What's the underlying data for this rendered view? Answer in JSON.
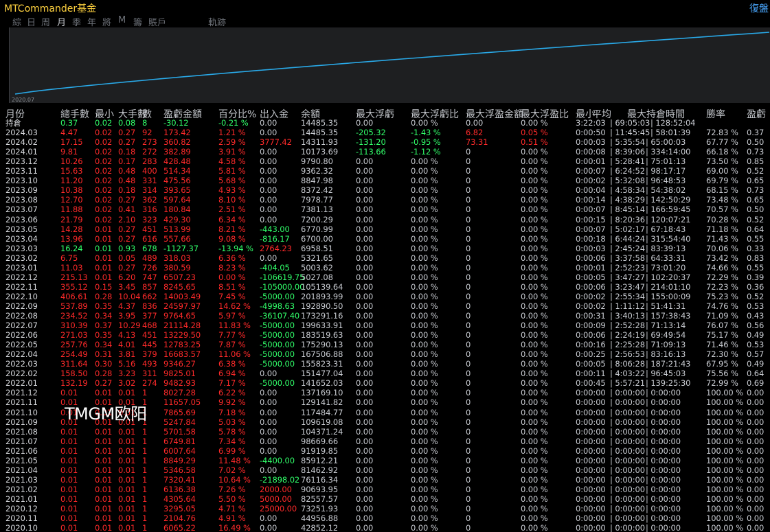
{
  "title": "MTCommander基金",
  "restore_label": "復盤",
  "tabs": [
    "綜",
    "日",
    "周",
    "月",
    "季",
    "年",
    "將",
    "M",
    "籌",
    "賬戶",
    "軌跡"
  ],
  "active_tab": "月",
  "chart": {
    "start_label": "2020.07",
    "line_color": "#29a9e8"
  },
  "columns": [
    "月份",
    "總手數",
    "最小",
    "大手數",
    "數",
    "盈虧金額",
    "百分比%",
    "出入金",
    "余額",
    "最大浮虧",
    "最大浮虧比",
    "最大浮盈金額",
    "最大浮盈比",
    "最小",
    "平均",
    "最大持倉時間",
    "勝率",
    "盈虧"
  ],
  "rows": [
    [
      "持倉",
      "0.37",
      "0.02",
      "0.08",
      "8",
      "-30.12",
      "-0.21 %",
      "0.00",
      "14485.35",
      "0.00",
      "0.00 %",
      "0.00",
      "0.00 %",
      "3:22:03",
      "69:05:03",
      "128:52:04",
      "",
      ""
    ],
    [
      "2024.03",
      "4.47",
      "0.02",
      "0.27",
      "92",
      "173.42",
      "1.21 %",
      "0.00",
      "14485.35",
      "-205.32",
      "-1.43 %",
      "6.82",
      "0.05 %",
      "0:00:50",
      "11:45:45",
      "58:01:39",
      "72.83 %",
      "0.37"
    ],
    [
      "2024.02",
      "17.15",
      "0.02",
      "0.27",
      "273",
      "360.82",
      "2.59 %",
      "3777.42",
      "14311.93",
      "-131.20",
      "-0.95 %",
      "73.31",
      "0.51 %",
      "0:00:03",
      "5:35:54",
      "65:00:03",
      "67.77 %",
      "0.50"
    ],
    [
      "2024.01",
      "9.81",
      "0.02",
      "0.18",
      "272",
      "382.89",
      "3.91 %",
      "0.00",
      "10173.69",
      "-113.66",
      "-1.12 %",
      "0",
      "0.00 %",
      "0:00:08",
      "8:39:06",
      "334:14:00",
      "66.18 %",
      "0.73"
    ],
    [
      "2023.12",
      "10.26",
      "0.02",
      "0.17",
      "283",
      "428.48",
      "4.58 %",
      "0.00",
      "9790.80",
      "0.00",
      "0.00 %",
      "0",
      "0.00 %",
      "0:00:01",
      "5:28:41",
      "75:01:13",
      "73.50 %",
      "0.85"
    ],
    [
      "2023.11",
      "15.63",
      "0.02",
      "0.48",
      "400",
      "514.34",
      "5.81 %",
      "0.00",
      "9362.32",
      "0.00",
      "0.00 %",
      "0",
      "0.00 %",
      "0:00:07",
      "6:24:52",
      "98:17:17",
      "69.00 %",
      "0.52"
    ],
    [
      "2023.10",
      "11.20",
      "0.02",
      "0.48",
      "331",
      "475.56",
      "5.68 %",
      "0.00",
      "8847.98",
      "0.00",
      "0.00 %",
      "0",
      "0.00 %",
      "0:00:02",
      "5:32:08",
      "96:48:53",
      "69.79 %",
      "0.65"
    ],
    [
      "2023.09",
      "10.38",
      "0.02",
      "0.18",
      "314",
      "393.65",
      "4.93 %",
      "0.00",
      "8372.42",
      "0.00",
      "0.00 %",
      "0",
      "0.00 %",
      "0:00:04",
      "4:58:34",
      "54:38:02",
      "68.15 %",
      "0.73"
    ],
    [
      "2023.08",
      "12.70",
      "0.02",
      "0.27",
      "362",
      "597.64",
      "8.10 %",
      "0.00",
      "7978.77",
      "0.00",
      "0.00 %",
      "0",
      "0.00 %",
      "0:00:14",
      "4:38:29",
      "142:50:29",
      "73.48 %",
      "0.65"
    ],
    [
      "2023.07",
      "11.88",
      "0.02",
      "0.41",
      "316",
      "180.84",
      "2.51 %",
      "0.00",
      "7381.13",
      "0.00",
      "0.00 %",
      "0",
      "0.00 %",
      "0:00:07",
      "8:45:14",
      "166:59:45",
      "70.57 %",
      "0.50"
    ],
    [
      "2023.06",
      "21.79",
      "0.02",
      "2.10",
      "323",
      "429.30",
      "6.34 %",
      "0.00",
      "7200.29",
      "0.00",
      "0.00 %",
      "0",
      "0.00 %",
      "0:00:15",
      "8:20:36",
      "120:07:21",
      "70.28 %",
      "0.52"
    ],
    [
      "2023.05",
      "14.28",
      "0.01",
      "0.27",
      "451",
      "513.99",
      "8.21 %",
      "-443.00",
      "6770.99",
      "0.00",
      "0.00 %",
      "0",
      "0.00 %",
      "0:00:07",
      "5:02:17",
      "67:18:43",
      "71.18 %",
      "0.64"
    ],
    [
      "2023.04",
      "13.96",
      "0.01",
      "0.27",
      "616",
      "557.66",
      "9.08 %",
      "-816.17",
      "6700.00",
      "0.00",
      "0.00 %",
      "0",
      "0.00 %",
      "0:00:18",
      "6:44:24",
      "315:54:40",
      "71.43 %",
      "0.55"
    ],
    [
      "2023.03",
      "16.24",
      "0.01",
      "0.93",
      "678",
      "-1127.37",
      "-13.94 %",
      "2764.23",
      "6958.51",
      "0.00",
      "0.00 %",
      "0",
      "0.00 %",
      "0:00:03",
      "2:45:24",
      "83:39:13",
      "70.06 %",
      "0.33"
    ],
    [
      "2023.02",
      "6.75",
      "0.01",
      "0.05",
      "489",
      "318.03",
      "6.36 %",
      "0.00",
      "5321.65",
      "0.00",
      "0.00 %",
      "0",
      "0.00 %",
      "0:00:06",
      "3:37:58",
      "64:33:31",
      "73.42 %",
      "0.83"
    ],
    [
      "2023.01",
      "11.03",
      "0.01",
      "0.27",
      "726",
      "380.59",
      "8.23 %",
      "-404.05",
      "5003.62",
      "0.00",
      "0.00 %",
      "0",
      "0.00 %",
      "0:00:01",
      "2:52:23",
      "73:01:20",
      "74.66 %",
      "0.55"
    ],
    [
      "2022.12",
      "215.13",
      "0.01",
      "6.20",
      "747",
      "6507.23",
      "0.00 %",
      "-106619.75",
      "5027.08",
      "0.00",
      "0.00 %",
      "0",
      "0.00 %",
      "0:00:05",
      "3:47:27",
      "102:20:37",
      "72.29 %",
      "0.39"
    ],
    [
      "2022.11",
      "355.12",
      "0.15",
      "3.45",
      "857",
      "8245.65",
      "8.51 %",
      "-105000.00",
      "105139.64",
      "0.00",
      "0.00 %",
      "0",
      "0.00 %",
      "0:00:06",
      "3:23:47",
      "214:01:10",
      "72.23 %",
      "0.36"
    ],
    [
      "2022.10",
      "406.61",
      "0.28",
      "10.04",
      "662",
      "14003.49",
      "7.45 %",
      "-5000.00",
      "201893.99",
      "0.00",
      "0.00 %",
      "0",
      "0.00 %",
      "0:00:02",
      "2:55:34",
      "155:00:09",
      "75.23 %",
      "0.52"
    ],
    [
      "2022.09",
      "537.89",
      "0.35",
      "4.37",
      "836",
      "24597.97",
      "14.62 %",
      "-4998.63",
      "192890.50",
      "0.00",
      "0.00 %",
      "0",
      "0.00 %",
      "0:00:02",
      "1:11:12",
      "51:41:31",
      "74.76 %",
      "0.53"
    ],
    [
      "2022.08",
      "234.52",
      "0.34",
      "3.95",
      "377",
      "9764.65",
      "5.97 %",
      "-36107.40",
      "173291.16",
      "0.00",
      "0.00 %",
      "0",
      "0.00 %",
      "0:00:31",
      "3:40:13",
      "157:38:43",
      "71.09 %",
      "0.43"
    ],
    [
      "2022.07",
      "310.39",
      "0.37",
      "10.29",
      "468",
      "21114.28",
      "11.83 %",
      "-5000.00",
      "199633.91",
      "0.00",
      "0.00 %",
      "0",
      "0.00 %",
      "0:00:09",
      "2:52:28",
      "71:13:14",
      "76.07 %",
      "0.56"
    ],
    [
      "2022.06",
      "271.03",
      "0.35",
      "4.13",
      "451",
      "13229.50",
      "7.77 %",
      "-5000.00",
      "183519.63",
      "0.00",
      "0.00 %",
      "0",
      "0.00 %",
      "0:00:06",
      "2:24:19",
      "69:49:54",
      "75.17 %",
      "0.49"
    ],
    [
      "2022.05",
      "257.76",
      "0.34",
      "4.01",
      "445",
      "12783.25",
      "7.87 %",
      "-5000.00",
      "175290.13",
      "0.00",
      "0.00 %",
      "0",
      "0.00 %",
      "0:00:16",
      "2:25:28",
      "71:09:13",
      "71.46 %",
      "0.53"
    ],
    [
      "2022.04",
      "254.49",
      "0.31",
      "3.81",
      "379",
      "16683.57",
      "11.06 %",
      "-5000.00",
      "167506.88",
      "0.00",
      "0.00 %",
      "0",
      "0.00 %",
      "0:00:25",
      "2:56:53",
      "83:16:13",
      "72.30 %",
      "0.57"
    ],
    [
      "2022.03",
      "311.64",
      "0.30",
      "5.16",
      "493",
      "9346.27",
      "6.38 %",
      "-5000.00",
      "155823.31",
      "0.00",
      "0.00 %",
      "0",
      "0.00 %",
      "0:00:05",
      "8:06:28",
      "187:21:43",
      "67.95 %",
      "0.49"
    ],
    [
      "2022.02",
      "158.50",
      "0.28",
      "3.23",
      "311",
      "9825.01",
      "6.94 %",
      "0.00",
      "151477.04",
      "0.00",
      "0.00 %",
      "0",
      "0.00 %",
      "0:00:11",
      "4:03:22",
      "96:45:03",
      "75.56 %",
      "0.64"
    ],
    [
      "2022.01",
      "132.19",
      "0.27",
      "3.02",
      "274",
      "9482.93",
      "7.17 %",
      "-5000.00",
      "141652.03",
      "0.00",
      "0.00 %",
      "0",
      "0.00 %",
      "0:00:45",
      "5:57:21",
      "139:25:30",
      "72.99 %",
      "0.69"
    ],
    [
      "2021.12",
      "0.01",
      "0.01",
      "0.01",
      "1",
      "8027.28",
      "6.22 %",
      "0.00",
      "137169.10",
      "0.00",
      "0.00 %",
      "0",
      "0.00 %",
      "0:00:00",
      "0:00:00",
      "0:00:00",
      "100.00 %",
      "0.00"
    ],
    [
      "2021.11",
      "0.01",
      "0.01",
      "0.01",
      "1",
      "11657.05",
      "9.92 %",
      "0.00",
      "129141.82",
      "0.00",
      "0.00 %",
      "0",
      "0.00 %",
      "0:00:00",
      "0:00:00",
      "0:00:00",
      "100.00 %",
      "0.00"
    ],
    [
      "2021.10",
      "0.01",
      "0.01",
      "0.01",
      "1",
      "7865.69",
      "7.18 %",
      "0.00",
      "117484.77",
      "0.00",
      "0.00 %",
      "0",
      "0.00 %",
      "0:00:00",
      "0:00:00",
      "0:00:00",
      "100.00 %",
      "0.00"
    ],
    [
      "2021.09",
      "0.01",
      "0.01",
      "0.01",
      "1",
      "5247.84",
      "5.03 %",
      "0.00",
      "109619.08",
      "0.00",
      "0.00 %",
      "0",
      "0.00 %",
      "0:00:00",
      "0:00:00",
      "0:00:00",
      "100.00 %",
      "0.00"
    ],
    [
      "2021.08",
      "0.01",
      "0.01",
      "0.01",
      "1",
      "5701.58",
      "5.78 %",
      "0.00",
      "104371.24",
      "0.00",
      "0.00 %",
      "0",
      "0.00 %",
      "0:00:00",
      "0:00:00",
      "0:00:00",
      "100.00 %",
      "0.00"
    ],
    [
      "2021.07",
      "0.01",
      "0.01",
      "0.01",
      "1",
      "6749.81",
      "7.34 %",
      "0.00",
      "98669.66",
      "0.00",
      "0.00 %",
      "0",
      "0.00 %",
      "0:00:00",
      "0:00:00",
      "0:00:00",
      "100.00 %",
      "0.00"
    ],
    [
      "2021.06",
      "0.01",
      "0.01",
      "0.01",
      "1",
      "6007.64",
      "6.99 %",
      "0.00",
      "91919.85",
      "0.00",
      "0.00 %",
      "0",
      "0.00 %",
      "0:00:00",
      "0:00:00",
      "0:00:00",
      "100.00 %",
      "0.00"
    ],
    [
      "2021.05",
      "0.01",
      "0.01",
      "0.01",
      "1",
      "8849.29",
      "11.48 %",
      "-4400.00",
      "85912.21",
      "0.00",
      "0.00 %",
      "0",
      "0.00 %",
      "0:00:00",
      "0:00:00",
      "0:00:00",
      "100.00 %",
      "0.00"
    ],
    [
      "2021.04",
      "0.01",
      "0.01",
      "0.01",
      "1",
      "5346.58",
      "7.02 %",
      "0.00",
      "81462.92",
      "0.00",
      "0.00 %",
      "0",
      "0.00 %",
      "0:00:00",
      "0:00:00",
      "0:00:00",
      "100.00 %",
      "0.00"
    ],
    [
      "2021.03",
      "0.01",
      "0.01",
      "0.01",
      "1",
      "7320.41",
      "10.64 %",
      "-21898.02",
      "76116.34",
      "0.00",
      "0.00 %",
      "0",
      "0.00 %",
      "0:00:00",
      "0:00:00",
      "0:00:00",
      "100.00 %",
      "0.00"
    ],
    [
      "2021.02",
      "0.01",
      "0.01",
      "0.01",
      "1",
      "6136.38",
      "7.26 %",
      "2000.00",
      "90693.95",
      "0.00",
      "0.00 %",
      "0",
      "0.00 %",
      "0:00:00",
      "0:00:00",
      "0:00:00",
      "100.00 %",
      "0.00"
    ],
    [
      "2021.01",
      "0.01",
      "0.01",
      "0.01",
      "1",
      "4305.64",
      "5.50 %",
      "5000.00",
      "82557.57",
      "0.00",
      "0.00 %",
      "0",
      "0.00 %",
      "0:00:00",
      "0:00:00",
      "0:00:00",
      "100.00 %",
      "0.00"
    ],
    [
      "2020.12",
      "0.01",
      "0.01",
      "0.01",
      "1",
      "3295.05",
      "4.71 %",
      "25000.00",
      "73251.93",
      "0.00",
      "0.00 %",
      "0",
      "0.00 %",
      "0:00:00",
      "0:00:00",
      "0:00:00",
      "100.00 %",
      "0.00"
    ],
    [
      "2020.11",
      "0.01",
      "0.01",
      "0.01",
      "1",
      "2104.76",
      "4.91 %",
      "0.00",
      "44956.88",
      "0.00",
      "0.00 %",
      "0",
      "0.00 %",
      "0:00:00",
      "0:00:00",
      "0:00:00",
      "100.00 %",
      "0.00"
    ],
    [
      "2020.10",
      "0.01",
      "0.01",
      "0.01",
      "1",
      "6065.22",
      "16.49 %",
      "0.00",
      "42852.12",
      "0.00",
      "0.00 %",
      "0",
      "0.00 %",
      "0:00:00",
      "0:00:00",
      "0:00:00",
      "100.00 %",
      "0.00"
    ]
  ],
  "watermark": "TMGM欧阳",
  "colors": {
    "background": "#000000",
    "chart_bg": "#1e1f21",
    "title": "#ffd23f",
    "positive": "#ff2a2a",
    "negative": "#31ff6a",
    "neutral": "#c9ccd2",
    "restore": "#4aa8ff"
  }
}
